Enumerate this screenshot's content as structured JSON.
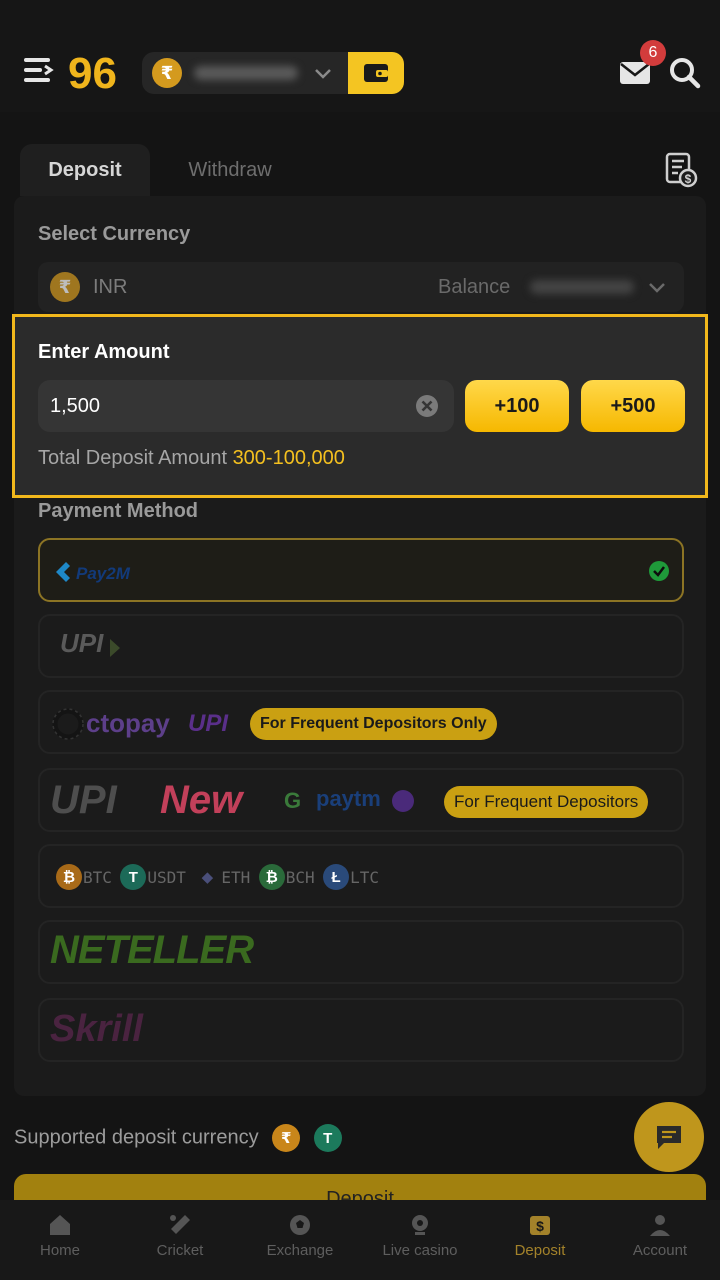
{
  "header": {
    "logo_text": "96",
    "mail_count": "6",
    "currency_symbol": "₹"
  },
  "tabs": [
    {
      "label": "Deposit"
    },
    {
      "label": "Withdraw"
    }
  ],
  "currency": {
    "section_label": "Select Currency",
    "code": "INR",
    "balance_label": "Balance"
  },
  "amount": {
    "title": "Enter Amount",
    "value": "1,500",
    "quick_add": [
      "+100",
      "+500"
    ],
    "range_label": "Total Deposit Amount",
    "range_value": "300-100,000"
  },
  "payment": {
    "section_label": "Payment Method",
    "methods": [
      {
        "name": "Pay2M"
      },
      {
        "name": "UPI"
      },
      {
        "name": "ctopay",
        "name2": "UPI",
        "badge": "For Frequent Depositors Only"
      },
      {
        "name": "UPI",
        "name2": "New",
        "badge": "For Frequent Depositors",
        "sub_brand": "paytm"
      },
      {
        "name": "crypto",
        "coins": [
          "BTC",
          "USDT",
          "ETH",
          "BCH",
          "LTC"
        ]
      },
      {
        "name": "NETELLER"
      },
      {
        "name": "Skrill"
      }
    ]
  },
  "supported_label": "Supported deposit currency",
  "deposit_button": "Deposit",
  "nav": [
    {
      "label": "Home"
    },
    {
      "label": "Cricket"
    },
    {
      "label": "Exchange"
    },
    {
      "label": "Live casino"
    },
    {
      "label": "Deposit"
    },
    {
      "label": "Account"
    }
  ],
  "colors": {
    "accent": "#f4c522",
    "background": "#141414"
  }
}
